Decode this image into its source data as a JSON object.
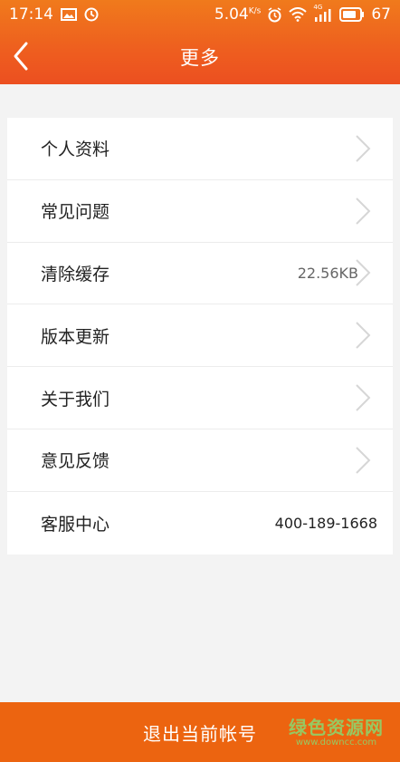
{
  "status_bar": {
    "time": "17:14",
    "speed": "5.04",
    "speed_unit": "K/s",
    "network": "4G",
    "battery": "67",
    "icons": [
      "image-icon",
      "clock-icon",
      "alarm-icon",
      "wifi-icon",
      "signal-icon",
      "battery-icon"
    ]
  },
  "header": {
    "title": "更多",
    "back_icon": "chevron-left-icon",
    "bg_color": "#ee5e1f"
  },
  "settings": {
    "items": [
      {
        "label": "个人资料",
        "value": ""
      },
      {
        "label": "常见问题",
        "value": ""
      },
      {
        "label": "清除缓存",
        "value": "22.56KB"
      },
      {
        "label": "版本更新",
        "value": ""
      },
      {
        "label": "关于我们",
        "value": ""
      },
      {
        "label": "意见反馈",
        "value": ""
      },
      {
        "label": "客服中心",
        "value": "400-189-1668"
      }
    ]
  },
  "footer": {
    "logout_label": "退出当前帐号",
    "bg_color": "#ec6410",
    "watermark_text": "绿色资源网",
    "watermark_url": "www.downcc.com"
  }
}
